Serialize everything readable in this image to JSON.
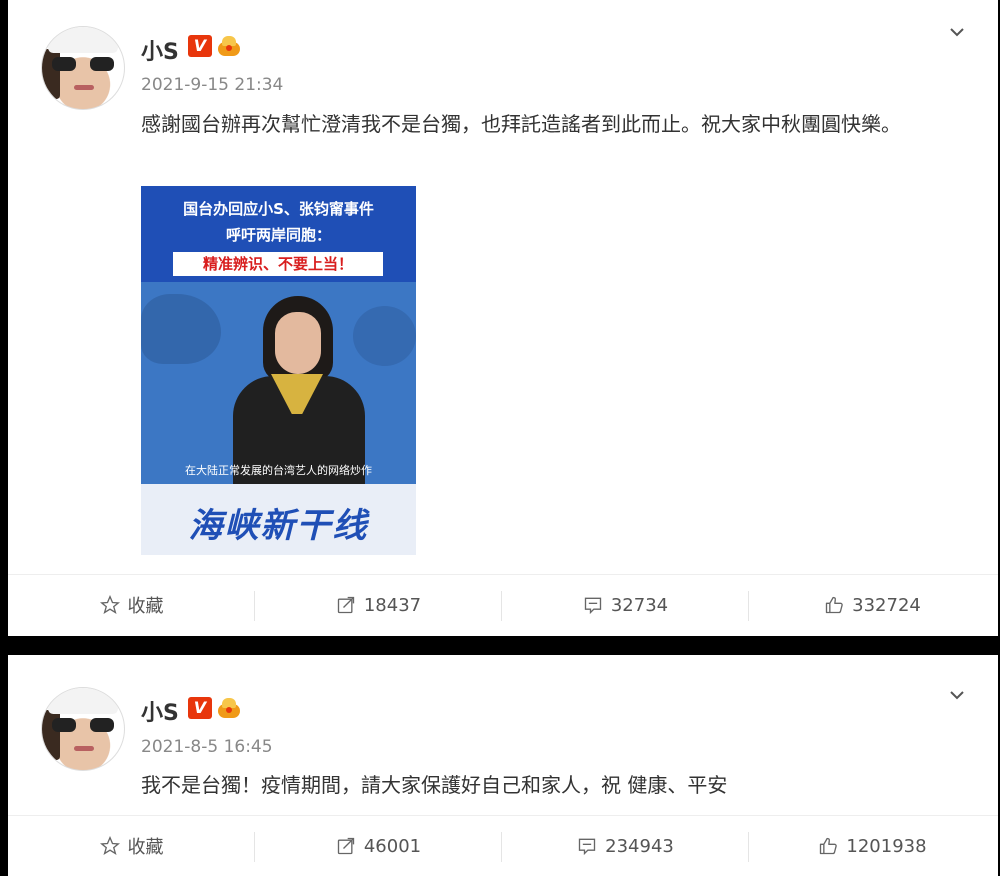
{
  "posts": [
    {
      "user_name": "小S",
      "verified_badge": "V",
      "timestamp": "2021-9-15 21:34",
      "text": "感謝國台辦再次幫忙澄清我不是台獨，也拜託造謠者到此而止。祝大家中秋團圓快樂。",
      "image": {
        "headline_1": "国台办回应小S、张钧甯事件",
        "headline_2": "呼吁两岸同胞：",
        "headline_3": "精准辨识、不要上当！",
        "caption": "在大陆正常发展的台湾艺人的网络炒作",
        "logo": "海峡新干线"
      },
      "actions": {
        "favorite": "收藏",
        "repost_count": "18437",
        "comment_count": "32734",
        "like_count": "332724"
      }
    },
    {
      "user_name": "小S",
      "verified_badge": "V",
      "timestamp": "2021-8-5 16:45",
      "text": "我不是台獨！疫情期間，請大家保護好自己和家人，祝 健康、平安",
      "actions": {
        "favorite": "收藏",
        "repost_count": "46001",
        "comment_count": "234943",
        "like_count": "1201938"
      }
    }
  ],
  "colors": {
    "verified_badge": "#e8360c",
    "crown": "#f09a18",
    "text": "#333333",
    "muted": "#888888",
    "news_blue": "#1f4fb6"
  },
  "icons": [
    "star-icon",
    "repost-icon",
    "comment-icon",
    "like-icon",
    "chevron-down-icon",
    "verified-icon",
    "crown-icon"
  ]
}
